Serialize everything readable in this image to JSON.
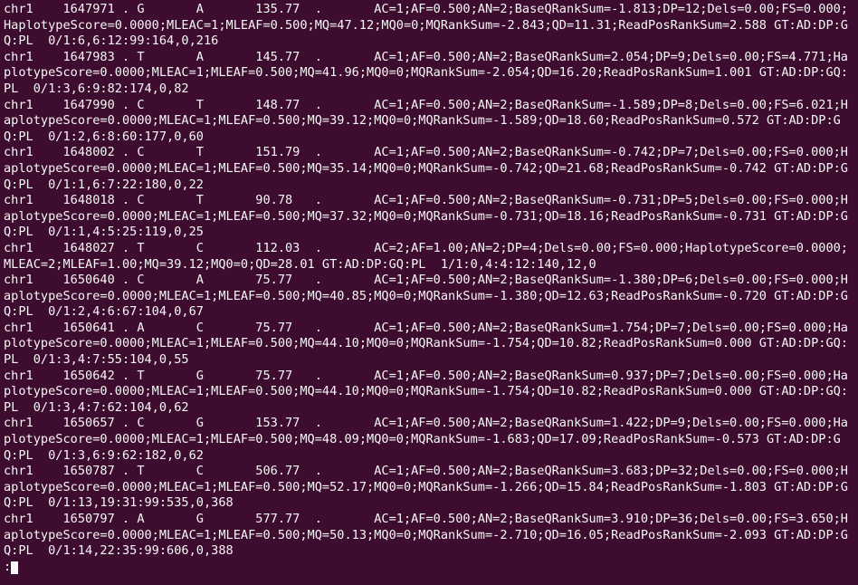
{
  "records": [
    {
      "chrom": "chr1",
      "pos": "1647971",
      "id": ".",
      "ref": "G",
      "alt": "A",
      "qual": "135.77",
      "filter": ".",
      "info": "AC=1;AF=0.500;AN=2;BaseQRankSum=-1.813;DP=12;Dels=0.00;FS=0.000;HaplotypeScore=0.0000;MLEAC=1;MLEAF=0.500;MQ=47.12;MQ0=0;MQRankSum=-2.843;QD=11.31;ReadPosRankSum=2.588",
      "format": "GT:AD:DP:GQ:PL",
      "sample": "0/1:6,6:12:99:164,0,216"
    },
    {
      "chrom": "chr1",
      "pos": "1647983",
      "id": ".",
      "ref": "T",
      "alt": "A",
      "qual": "145.77",
      "filter": ".",
      "info": "AC=1;AF=0.500;AN=2;BaseQRankSum=2.054;DP=9;Dels=0.00;FS=4.771;HaplotypeScore=0.0000;MLEAC=1;MLEAF=0.500;MQ=41.96;MQ0=0;MQRankSum=-2.054;QD=16.20;ReadPosRankSum=1.001",
      "format": "GT:AD:DP:GQ:PL",
      "sample": "0/1:3,6:9:82:174,0,82"
    },
    {
      "chrom": "chr1",
      "pos": "1647990",
      "id": ".",
      "ref": "C",
      "alt": "T",
      "qual": "148.77",
      "filter": ".",
      "info": "AC=1;AF=0.500;AN=2;BaseQRankSum=-1.589;DP=8;Dels=0.00;FS=6.021;HaplotypeScore=0.0000;MLEAC=1;MLEAF=0.500;MQ=39.12;MQ0=0;MQRankSum=-1.589;QD=18.60;ReadPosRankSum=0.572",
      "format": "GT:AD:DP:GQ:PL",
      "sample": "0/1:2,6:8:60:177,0,60"
    },
    {
      "chrom": "chr1",
      "pos": "1648002",
      "id": ".",
      "ref": "C",
      "alt": "T",
      "qual": "151.79",
      "filter": ".",
      "info": "AC=1;AF=0.500;AN=2;BaseQRankSum=-0.742;DP=7;Dels=0.00;FS=0.000;HaplotypeScore=0.0000;MLEAC=1;MLEAF=0.500;MQ=35.14;MQ0=0;MQRankSum=-0.742;QD=21.68;ReadPosRankSum=-0.742",
      "format": "GT:AD:DP:GQ:PL",
      "sample": "0/1:1,6:7:22:180,0,22"
    },
    {
      "chrom": "chr1",
      "pos": "1648018",
      "id": ".",
      "ref": "C",
      "alt": "T",
      "qual": "90.78",
      "filter": ".",
      "info": "AC=1;AF=0.500;AN=2;BaseQRankSum=-0.731;DP=5;Dels=0.00;FS=0.000;HaplotypeScore=0.0000;MLEAC=1;MLEAF=0.500;MQ=37.32;MQ0=0;MQRankSum=-0.731;QD=18.16;ReadPosRankSum=-0.731",
      "format": "GT:AD:DP:GQ:PL",
      "sample": "0/1:1,4:5:25:119,0,25"
    },
    {
      "chrom": "chr1",
      "pos": "1648027",
      "id": ".",
      "ref": "T",
      "alt": "C",
      "qual": "112.03",
      "filter": ".",
      "info": "AC=2;AF=1.00;AN=2;DP=4;Dels=0.00;FS=0.000;HaplotypeScore=0.0000;MLEAC=2;MLEAF=1.00;MQ=39.12;MQ0=0;QD=28.01",
      "format": "GT:AD:DP:GQ:PL",
      "sample": "1/1:0,4:4:12:140,12,0"
    },
    {
      "chrom": "chr1",
      "pos": "1650640",
      "id": ".",
      "ref": "C",
      "alt": "A",
      "qual": "75.77",
      "filter": ".",
      "info": "AC=1;AF=0.500;AN=2;BaseQRankSum=-1.380;DP=6;Dels=0.00;FS=0.000;HaplotypeScore=0.0000;MLEAC=1;MLEAF=0.500;MQ=40.85;MQ0=0;MQRankSum=-1.380;QD=12.63;ReadPosRankSum=-0.720",
      "format": "GT:AD:DP:GQ:PL",
      "sample": "0/1:2,4:6:67:104,0,67"
    },
    {
      "chrom": "chr1",
      "pos": "1650641",
      "id": ".",
      "ref": "A",
      "alt": "C",
      "qual": "75.77",
      "filter": ".",
      "info": "AC=1;AF=0.500;AN=2;BaseQRankSum=1.754;DP=7;Dels=0.00;FS=0.000;HaplotypeScore=0.0000;MLEAC=1;MLEAF=0.500;MQ=44.10;MQ0=0;MQRankSum=-1.754;QD=10.82;ReadPosRankSum=0.000",
      "format": "GT:AD:DP:GQ:PL",
      "sample": "0/1:3,4:7:55:104,0,55"
    },
    {
      "chrom": "chr1",
      "pos": "1650642",
      "id": ".",
      "ref": "T",
      "alt": "G",
      "qual": "75.77",
      "filter": ".",
      "info": "AC=1;AF=0.500;AN=2;BaseQRankSum=0.937;DP=7;Dels=0.00;FS=0.000;HaplotypeScore=0.0000;MLEAC=1;MLEAF=0.500;MQ=44.10;MQ0=0;MQRankSum=-1.754;QD=10.82;ReadPosRankSum=0.000",
      "format": "GT:AD:DP:GQ:PL",
      "sample": "0/1:3,4:7:62:104,0,62"
    },
    {
      "chrom": "chr1",
      "pos": "1650657",
      "id": ".",
      "ref": "C",
      "alt": "G",
      "qual": "153.77",
      "filter": ".",
      "info": "AC=1;AF=0.500;AN=2;BaseQRankSum=1.422;DP=9;Dels=0.00;FS=0.000;HaplotypeScore=0.0000;MLEAC=1;MLEAF=0.500;MQ=48.09;MQ0=0;MQRankSum=-1.683;QD=17.09;ReadPosRankSum=-0.573",
      "format": "GT:AD:DP:GQ:PL",
      "sample": "0/1:3,6:9:62:182,0,62"
    },
    {
      "chrom": "chr1",
      "pos": "1650787",
      "id": ".",
      "ref": "T",
      "alt": "C",
      "qual": "506.77",
      "filter": ".",
      "info": "AC=1;AF=0.500;AN=2;BaseQRankSum=3.683;DP=32;Dels=0.00;FS=0.000;HaplotypeScore=0.0000;MLEAC=1;MLEAF=0.500;MQ=52.17;MQ0=0;MQRankSum=-1.266;QD=15.84;ReadPosRankSum=-1.803",
      "format": "GT:AD:DP:GQ:PL",
      "sample": "0/1:13,19:31:99:535,0,368"
    },
    {
      "chrom": "chr1",
      "pos": "1650797",
      "id": ".",
      "ref": "A",
      "alt": "G",
      "qual": "577.77",
      "filter": ".",
      "info": "AC=1;AF=0.500;AN=2;BaseQRankSum=3.910;DP=36;Dels=0.00;FS=3.650;HaplotypeScore=0.0000;MLEAC=1;MLEAF=0.500;MQ=50.13;MQ0=0;MQRankSum=-2.710;QD=16.05;ReadPosRankSum=-2.093",
      "format": "GT:AD:DP:GQ:PL",
      "sample": "0/1:14,22:35:99:606,0,388"
    }
  ],
  "prompt": ":"
}
